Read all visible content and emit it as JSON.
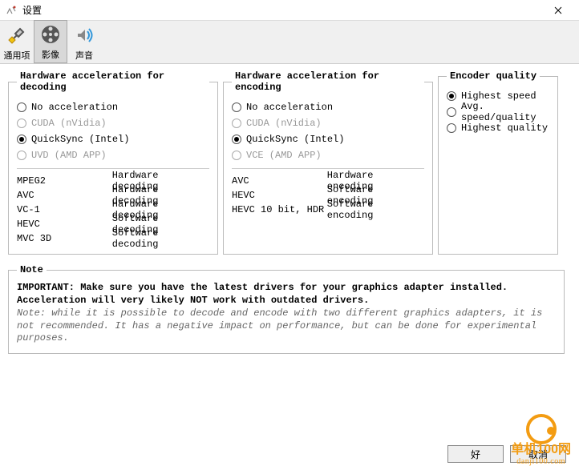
{
  "window": {
    "title": "设置"
  },
  "toolbar": {
    "general": "通用项",
    "video": "影像",
    "sound": "声音"
  },
  "decoding": {
    "legend": "Hardware acceleration for decoding",
    "opts": {
      "none": "No acceleration",
      "cuda": "CUDA (nVidia)",
      "qs": "QuickSync (Intel)",
      "uvd": "UVD (AMD APP)"
    },
    "codecs": [
      {
        "name": "MPEG2",
        "mode": "Hardware decoding"
      },
      {
        "name": "AVC",
        "mode": "Hardware decoding"
      },
      {
        "name": "VC-1",
        "mode": "Hardware decoding"
      },
      {
        "name": "HEVC",
        "mode": "Software decoding"
      },
      {
        "name": "MVC 3D",
        "mode": "Software decoding"
      }
    ]
  },
  "encoding": {
    "legend": "Hardware acceleration for encoding",
    "opts": {
      "none": "No acceleration",
      "cuda": "CUDA (nVidia)",
      "qs": "QuickSync (Intel)",
      "vce": "VCE (AMD APP)"
    },
    "codecs": [
      {
        "name": "AVC",
        "mode": "Hardware encoding"
      },
      {
        "name": "HEVC",
        "mode": "Software encoding"
      },
      {
        "name": "HEVC 10 bit, HDR",
        "mode": "Software encoding"
      }
    ]
  },
  "quality": {
    "legend": "Encoder quality",
    "opts": {
      "speed": "Highest speed",
      "avg": "Avg. speed/quality",
      "quality": "Highest quality"
    }
  },
  "note": {
    "legend": "Note",
    "bold1": "IMPORTANT: Make sure you have the latest drivers for your graphics adapter installed.",
    "bold2": "Acceleration will very likely NOT work with outdated drivers.",
    "italic": "Note: while it is possible to decode and encode with two different graphics adapters, it is not recommended. It has a negative impact on performance, but can be done for experimental purposes."
  },
  "footer": {
    "ok": "好",
    "cancel": "取消"
  },
  "watermark": {
    "brand": "单机100网",
    "url": "danji100.com"
  }
}
